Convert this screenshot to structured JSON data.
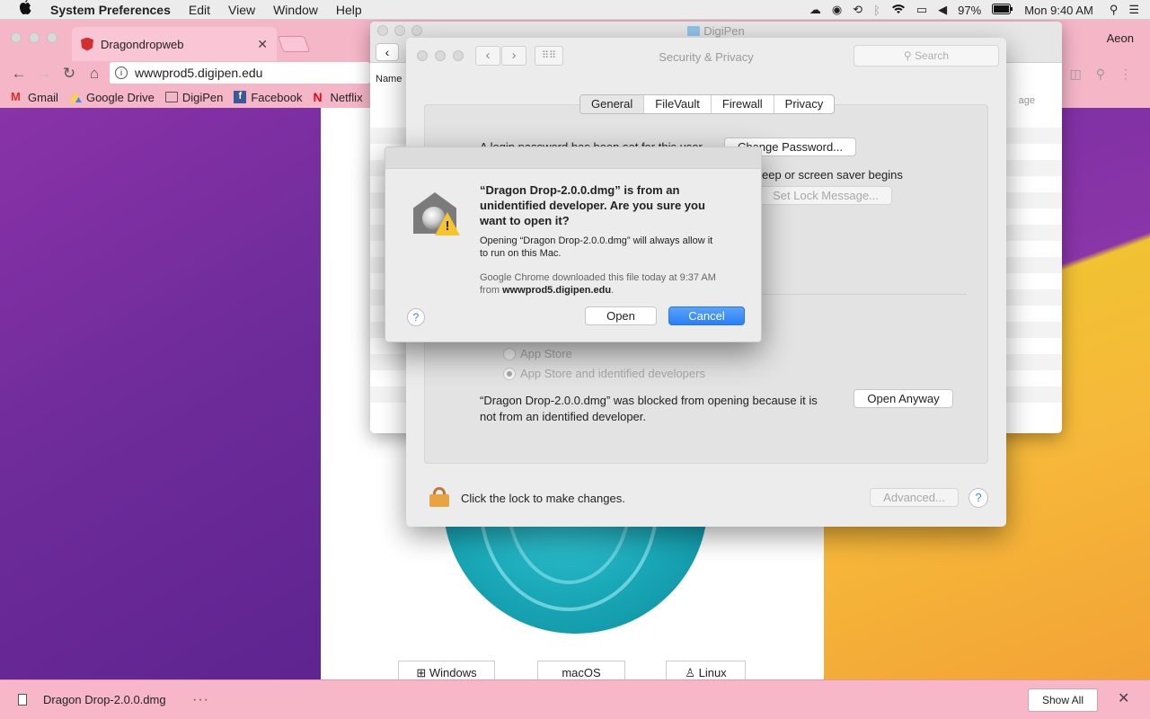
{
  "menubar": {
    "app_name": "System Preferences",
    "menus": [
      "Edit",
      "View",
      "Window",
      "Help"
    ],
    "battery": "97%",
    "clock": "Mon 9:40 AM"
  },
  "browser": {
    "tab_title": "Dragondropweb",
    "profile": "Aeon",
    "url": "wwwprod5.digipen.edu",
    "bookmarks": [
      "Gmail",
      "Google Drive",
      "DigiPen",
      "Facebook",
      "Netflix"
    ]
  },
  "page": {
    "downloads": [
      "Windows",
      "macOS",
      "Linux"
    ]
  },
  "finder": {
    "title": "DigiPen",
    "col_name": "Name",
    "col_right": "age"
  },
  "security": {
    "title": "Security & Privacy",
    "search_placeholder": "Search",
    "tabs": [
      "General",
      "FileVault",
      "Firewall",
      "Privacy"
    ],
    "login_text": "A login password has been set for this user",
    "change_password": "Change Password...",
    "sleep_text": "eep or screen saver begins",
    "set_lock_message": "Set Lock Message...",
    "radio_app_store": "App Store",
    "radio_identified": "App Store and identified developers",
    "blocked_text_1": "“Dragon Drop-2.0.0.dmg” was blocked from opening because it is",
    "blocked_text_2": "not from an identified developer.",
    "open_anyway": "Open Anyway",
    "lock_text": "Click the lock to make changes.",
    "advanced": "Advanced..."
  },
  "dialog": {
    "title_1": "“Dragon Drop-2.0.0.dmg” is from an",
    "title_2": "unidentified developer. Are you sure you",
    "title_3": "want to open it?",
    "msg_1": "Opening “Dragon Drop-2.0.0.dmg” will always allow it",
    "msg_2": "to run on this Mac.",
    "src_1": "Google Chrome downloaded this file today at 9:37 AM",
    "src_from": "from",
    "src_host": "wwwprod5.digipen.edu",
    "src_end": ".",
    "open": "Open",
    "cancel": "Cancel"
  },
  "download_bar": {
    "file_name": "Dragon Drop-2.0.0.dmg",
    "more": "···",
    "show_all": "Show All"
  },
  "colors": {
    "chrome_tint": "#f5b6c8",
    "accent_blue": "#2a7ff4",
    "lock_orange": "#e8a440"
  }
}
